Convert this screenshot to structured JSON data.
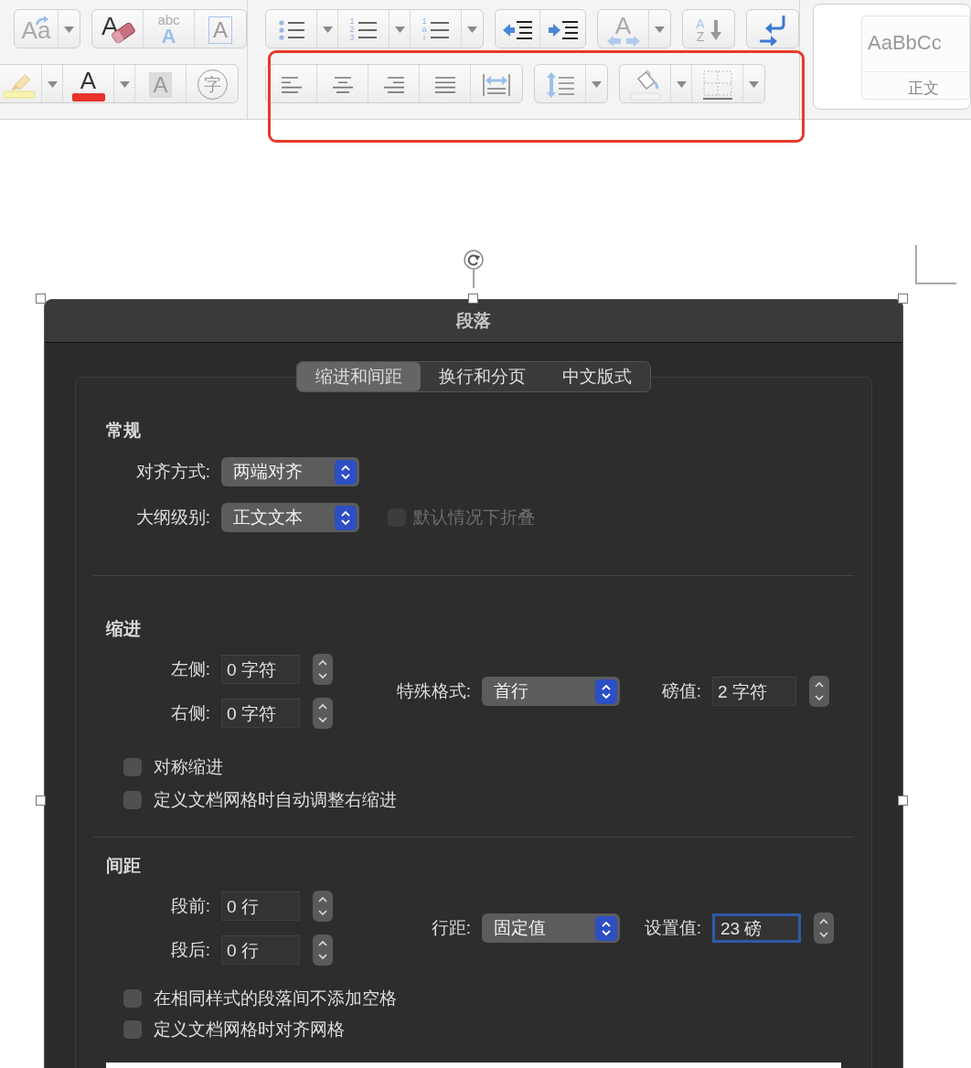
{
  "toolbar": {
    "left_rows": [
      [
        {
          "buttons": [
            {
              "kind": "change-case",
              "glyphs": [
                "Aa"
              ]
            },
            {
              "kind": "dropdown"
            }
          ]
        },
        {
          "buttons": [
            {
              "kind": "clear-format",
              "glyphs": [
                "A"
              ]
            },
            {
              "kind": "text-effects",
              "glyphs": [
                "abc",
                "A"
              ]
            },
            {
              "kind": "char-border",
              "glyphs": [
                "A"
              ]
            }
          ]
        }
      ],
      [
        {
          "buttons": [
            {
              "kind": "highlight"
            },
            {
              "kind": "dropdown"
            },
            {
              "kind": "font-color",
              "glyphs": [
                "A"
              ]
            },
            {
              "kind": "dropdown"
            },
            {
              "kind": "char-shading",
              "glyphs": [
                "A"
              ]
            },
            {
              "kind": "enclosed-char",
              "glyphs": [
                "字"
              ]
            }
          ]
        }
      ]
    ],
    "mid_rows": [
      [
        {
          "buttons": [
            {
              "kind": "bullets"
            },
            {
              "kind": "dropdown"
            },
            {
              "kind": "numbering",
              "glyphs": [
                "1",
                "2",
                "3"
              ]
            },
            {
              "kind": "dropdown"
            },
            {
              "kind": "multilevel",
              "glyphs": [
                "1",
                "a",
                "i"
              ]
            },
            {
              "kind": "dropdown"
            }
          ]
        },
        {
          "buttons": [
            {
              "kind": "outdent"
            },
            {
              "kind": "indent"
            }
          ]
        },
        {
          "buttons": [
            {
              "kind": "char-scale",
              "glyphs": [
                "A"
              ]
            },
            {
              "kind": "dropdown"
            }
          ]
        },
        {
          "buttons": [
            {
              "kind": "sort",
              "glyphs": [
                "A",
                "Z"
              ]
            }
          ]
        },
        {
          "buttons": [
            {
              "kind": "para-mark"
            }
          ]
        }
      ],
      [
        {
          "buttons": [
            {
              "kind": "align-left"
            },
            {
              "kind": "align-center"
            },
            {
              "kind": "align-right"
            },
            {
              "kind": "justify"
            },
            {
              "kind": "distribute"
            }
          ]
        },
        {
          "buttons": [
            {
              "kind": "line-spacing"
            },
            {
              "kind": "dropdown"
            }
          ]
        },
        {
          "buttons": [
            {
              "kind": "fill"
            },
            {
              "kind": "dropdown"
            },
            {
              "kind": "borders"
            },
            {
              "kind": "dropdown"
            }
          ]
        }
      ]
    ],
    "styles": {
      "sample": "AaBbCc",
      "name": "正文"
    }
  },
  "dialog": {
    "title": "段落",
    "tabs": [
      {
        "label": "缩进和间距",
        "selected": true
      },
      {
        "label": "换行和分页",
        "selected": false
      },
      {
        "label": "中文版式",
        "selected": false
      }
    ],
    "general": {
      "heading": "常规",
      "alignment": {
        "label": "对齐方式:",
        "value": "两端对齐"
      },
      "outline": {
        "label": "大纲级别:",
        "value": "正文文本"
      },
      "collapse": {
        "label": "默认情况下折叠",
        "checked": false,
        "disabled": true
      }
    },
    "indent": {
      "heading": "缩进",
      "fields": [
        {
          "label": "左侧:",
          "value": "0 字符"
        },
        {
          "label": "右侧:",
          "value": "0 字符"
        }
      ],
      "special": {
        "label": "特殊格式:",
        "value": "首行"
      },
      "by": {
        "label": "磅值:",
        "value": "2 字符",
        "focused": false
      },
      "options": [
        {
          "label": "对称缩进",
          "checked": false
        },
        {
          "label": "定义文档网格时自动调整右缩进",
          "checked": false
        }
      ]
    },
    "spacing": {
      "heading": "间距",
      "fields": [
        {
          "label": "段前:",
          "value": "0 行"
        },
        {
          "label": "段后:",
          "value": "0 行"
        }
      ],
      "special": {
        "label": "行距:",
        "value": "固定值"
      },
      "by": {
        "label": "设置值:",
        "value": "23 磅",
        "focused": true
      },
      "options": [
        {
          "label": "在相同样式的段落间不添加空格",
          "checked": false
        },
        {
          "label": "定义文档网格时对齐网格",
          "checked": false
        }
      ]
    }
  }
}
